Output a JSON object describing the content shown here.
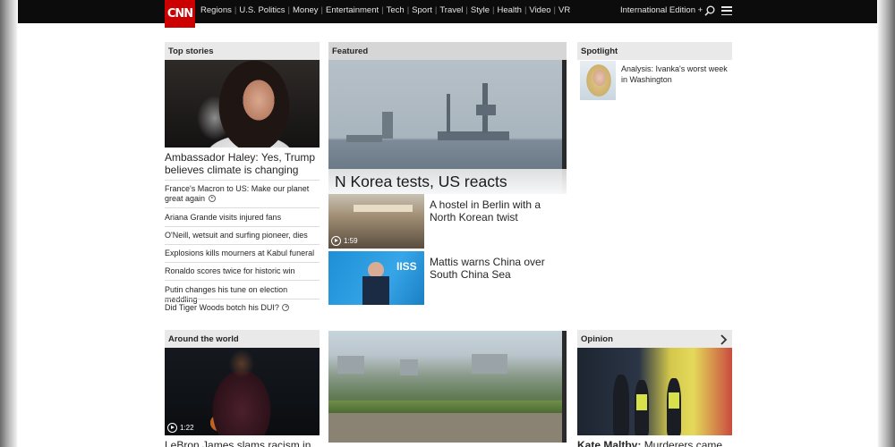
{
  "header": {
    "logo_text": "CNN",
    "nav": [
      "Regions",
      "U.S. Politics",
      "Money",
      "Entertainment",
      "Tech",
      "Sport",
      "Travel",
      "Style",
      "Health",
      "Video",
      "VR"
    ],
    "edition": "International Edition +"
  },
  "top_stories": {
    "title": "Top stories",
    "lead": "Ambassador Haley: Yes, Trump believes climate is changing",
    "items": [
      {
        "text": "France's Macron to US: Make our planet great again",
        "video": true
      },
      {
        "text": "Ariana Grande visits injured fans",
        "video": false
      },
      {
        "text": "O'Neill, wetsuit and surfing pioneer, dies",
        "video": false
      },
      {
        "text": "Explosions kills mourners at Kabul funeral",
        "video": false
      },
      {
        "text": "Ronaldo scores twice for historic win",
        "video": false
      },
      {
        "text": "Putin changes his tune on election meddling",
        "video": false
      },
      {
        "text": "Did Tiger Woods botch his DUI?",
        "video": true
      }
    ]
  },
  "featured": {
    "title": "Featured",
    "headline": "N Korea tests, US reacts",
    "items": [
      {
        "text": "A hostel in Berlin with a North Korean twist",
        "duration": "1:59"
      },
      {
        "text": "Mattis warns China over South China Sea"
      }
    ],
    "iiss_text": "IISS"
  },
  "spotlight": {
    "title": "Spotlight",
    "item": "Analysis: Ivanka's worst week in Washington"
  },
  "around_world": {
    "title": "Around the world",
    "duration": "1:22",
    "lead": "LeBron James slams racism in"
  },
  "opinion": {
    "title": "Opinion",
    "author": "Kate Maltby:",
    "lead": "Murderers came"
  },
  "colors": {
    "brand_red": "#cc0000",
    "header_bg": "#0c0c0c",
    "section_header_bg": "#e9e9e9"
  }
}
